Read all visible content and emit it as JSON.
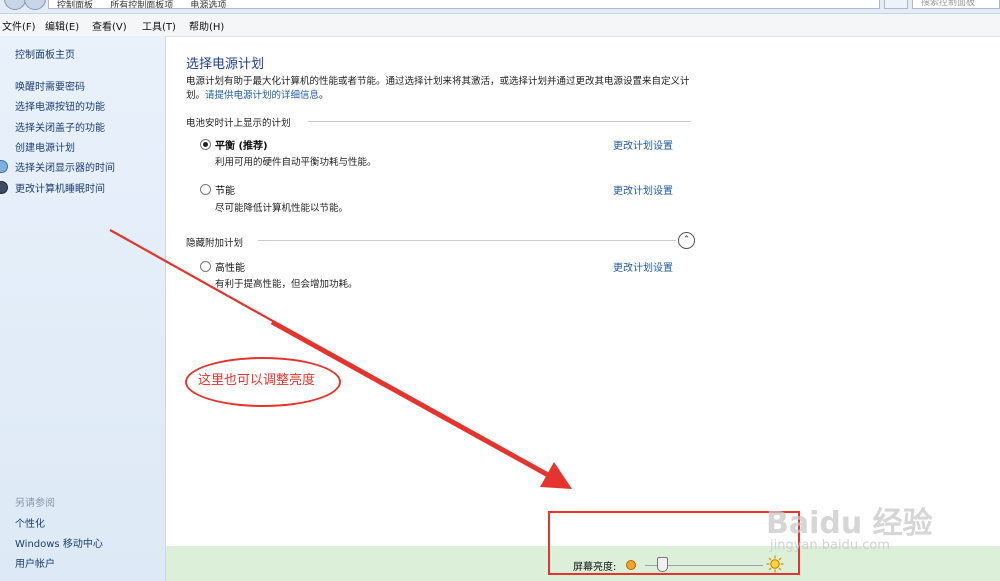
{
  "address_bar": {
    "crumbs": [
      "控制面板",
      "所有控制面板项",
      "电源选项"
    ],
    "search_placeholder": "搜索控制面板"
  },
  "menu": [
    "文件(F)",
    "编辑(E)",
    "查看(V)",
    "工具(T)",
    "帮助(H)"
  ],
  "sidebar": {
    "home": "控制面板主页",
    "items": [
      {
        "label": "唤醒时需要密码",
        "icon": ""
      },
      {
        "label": "选择电源按钮的功能",
        "icon": ""
      },
      {
        "label": "选择关闭盖子的功能",
        "icon": ""
      },
      {
        "label": "创建电源计划",
        "icon": ""
      },
      {
        "label": "选择关闭显示器的时间",
        "icon": "display-icon"
      },
      {
        "label": "更改计算机睡眠时间",
        "icon": "moon-icon"
      }
    ],
    "see_also_title": "另请参阅",
    "see_also": [
      "个性化",
      "Windows 移动中心",
      "用户帐户"
    ]
  },
  "main": {
    "title": "选择电源计划",
    "intro": "电源计划有助于最大化计算机的性能或者节能。通过选择计划来将其激活，或选择计划并通过更改其电源设置来自定义计划。",
    "intro_link": "请提供电源计划的详细信息",
    "intro_end": "。",
    "group1_title": "电池安时计上显示的计划",
    "group2_title": "隐藏附加计划",
    "plans": [
      {
        "name": "平衡 (推荐)",
        "desc": "利用可用的硬件自动平衡功耗与性能。",
        "link": "更改计划设置",
        "selected": true
      },
      {
        "name": "节能",
        "desc": "尽可能降低计算机性能以节能。",
        "link": "更改计划设置",
        "selected": false
      },
      {
        "name": "高性能",
        "desc": "有利于提高性能，但会增加功耗。",
        "link": "更改计划设置",
        "selected": false
      }
    ]
  },
  "brightness": {
    "label": "屏幕亮度:",
    "level_fraction": 0.12
  },
  "annotation": {
    "text": "这里也可以调整亮度",
    "color": "#e5342d"
  },
  "watermark": {
    "logo": "Baidu 经验",
    "url": "jingyan.baidu.com"
  }
}
